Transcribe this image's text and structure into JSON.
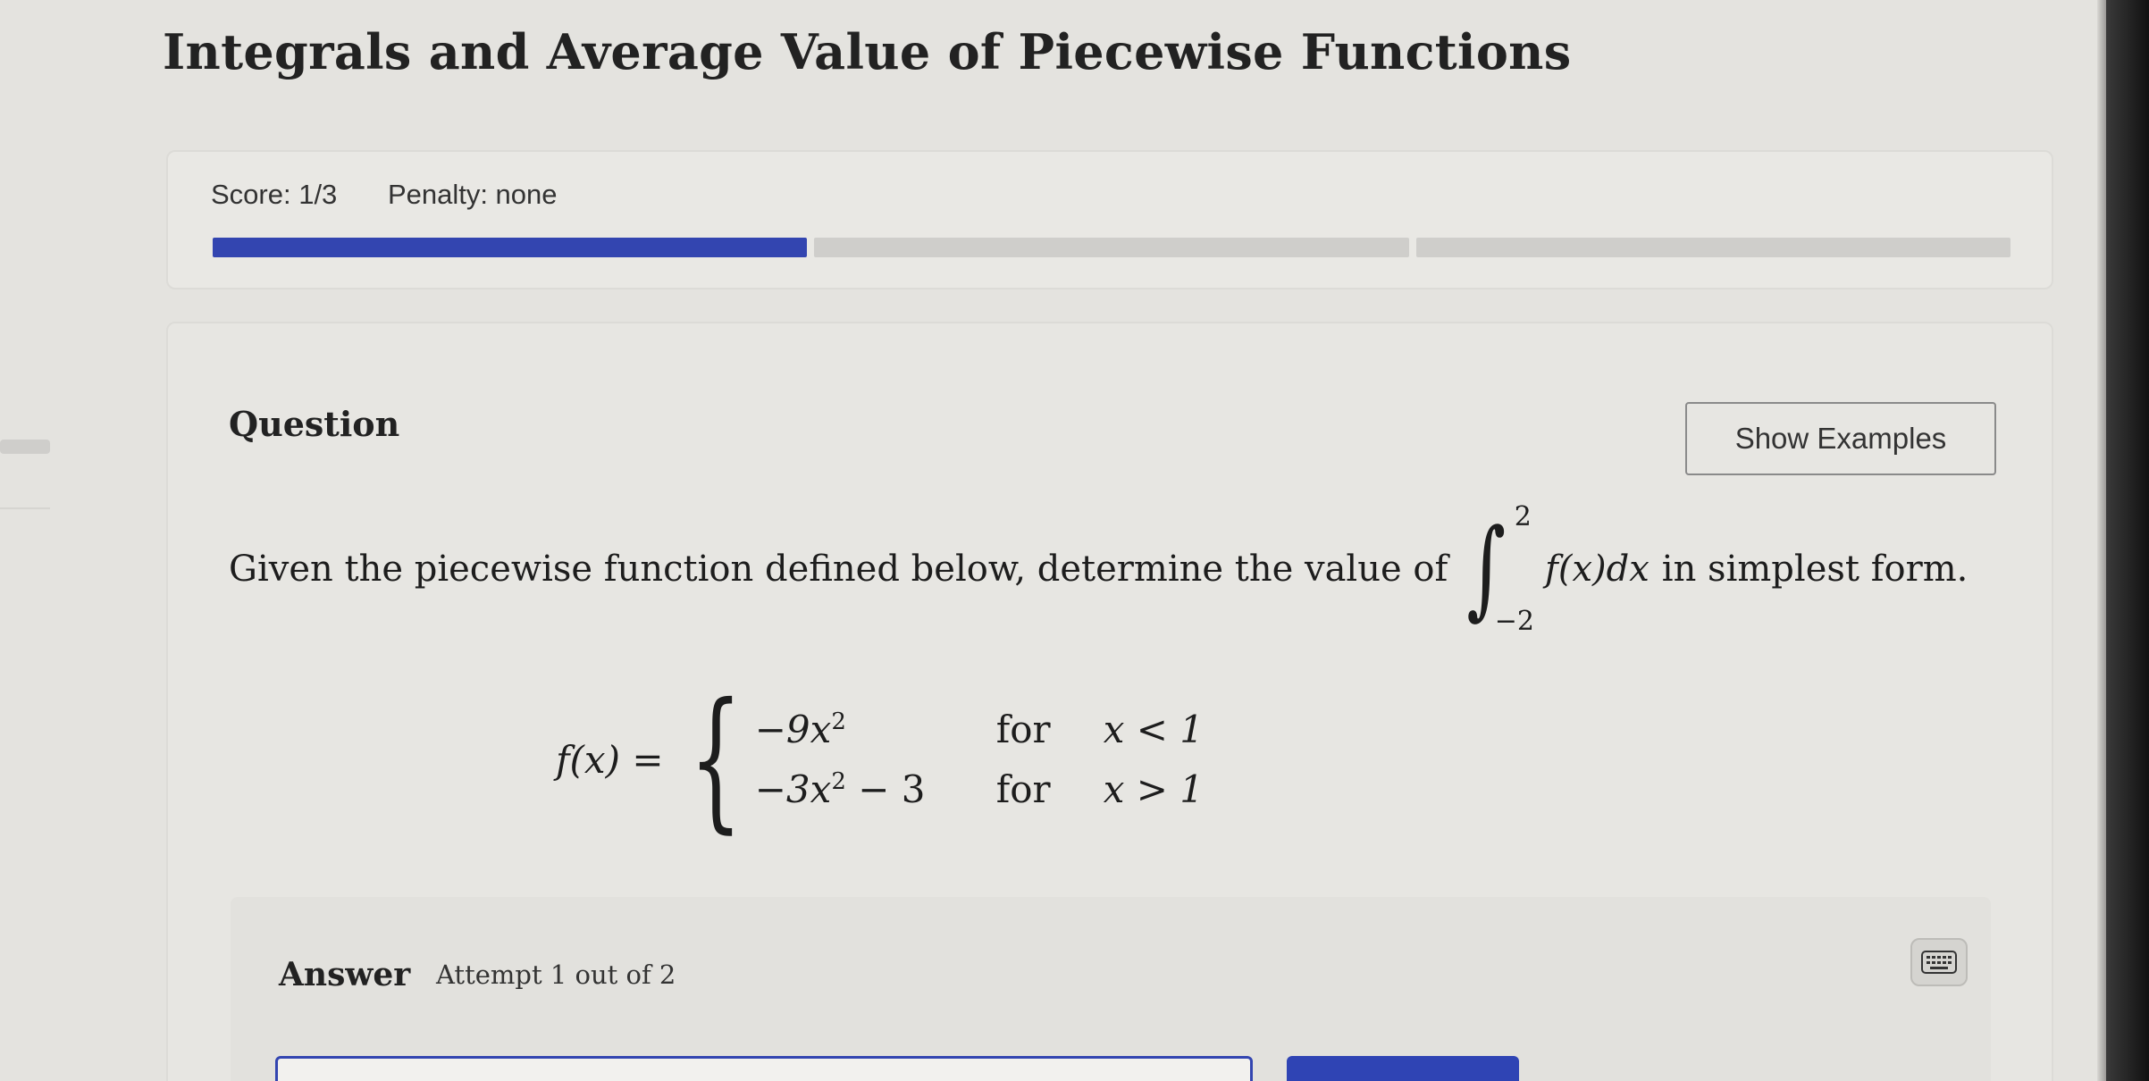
{
  "page": {
    "title": "Integrals and Average Value of Piecewise Functions"
  },
  "score_bar": {
    "score_label": "Score: 1/3",
    "penalty_label": "Penalty: none",
    "segments_total": 3,
    "segments_filled": 1,
    "fill_color": "#3345b0"
  },
  "question": {
    "heading": "Question",
    "show_examples_label": "Show Examples",
    "prompt_before": "Given the piecewise function defined below, determine the value of",
    "integral_upper": "2",
    "integral_lower": "−2",
    "integrand": "f(x)dx",
    "prompt_after": "in simplest form.",
    "function_lhs": "f(x) =",
    "cases": [
      {
        "expr": "−9x",
        "exp": "2",
        "tail": "",
        "word": "for",
        "cond": "x < 1"
      },
      {
        "expr": "−3x",
        "exp": "2",
        "tail": " − 3",
        "word": "for",
        "cond": "x > 1"
      }
    ]
  },
  "answer": {
    "label": "Answer",
    "attempt_text": "Attempt 1 out of 2",
    "keyboard_icon": "keyboard-icon",
    "submit_label": ""
  }
}
